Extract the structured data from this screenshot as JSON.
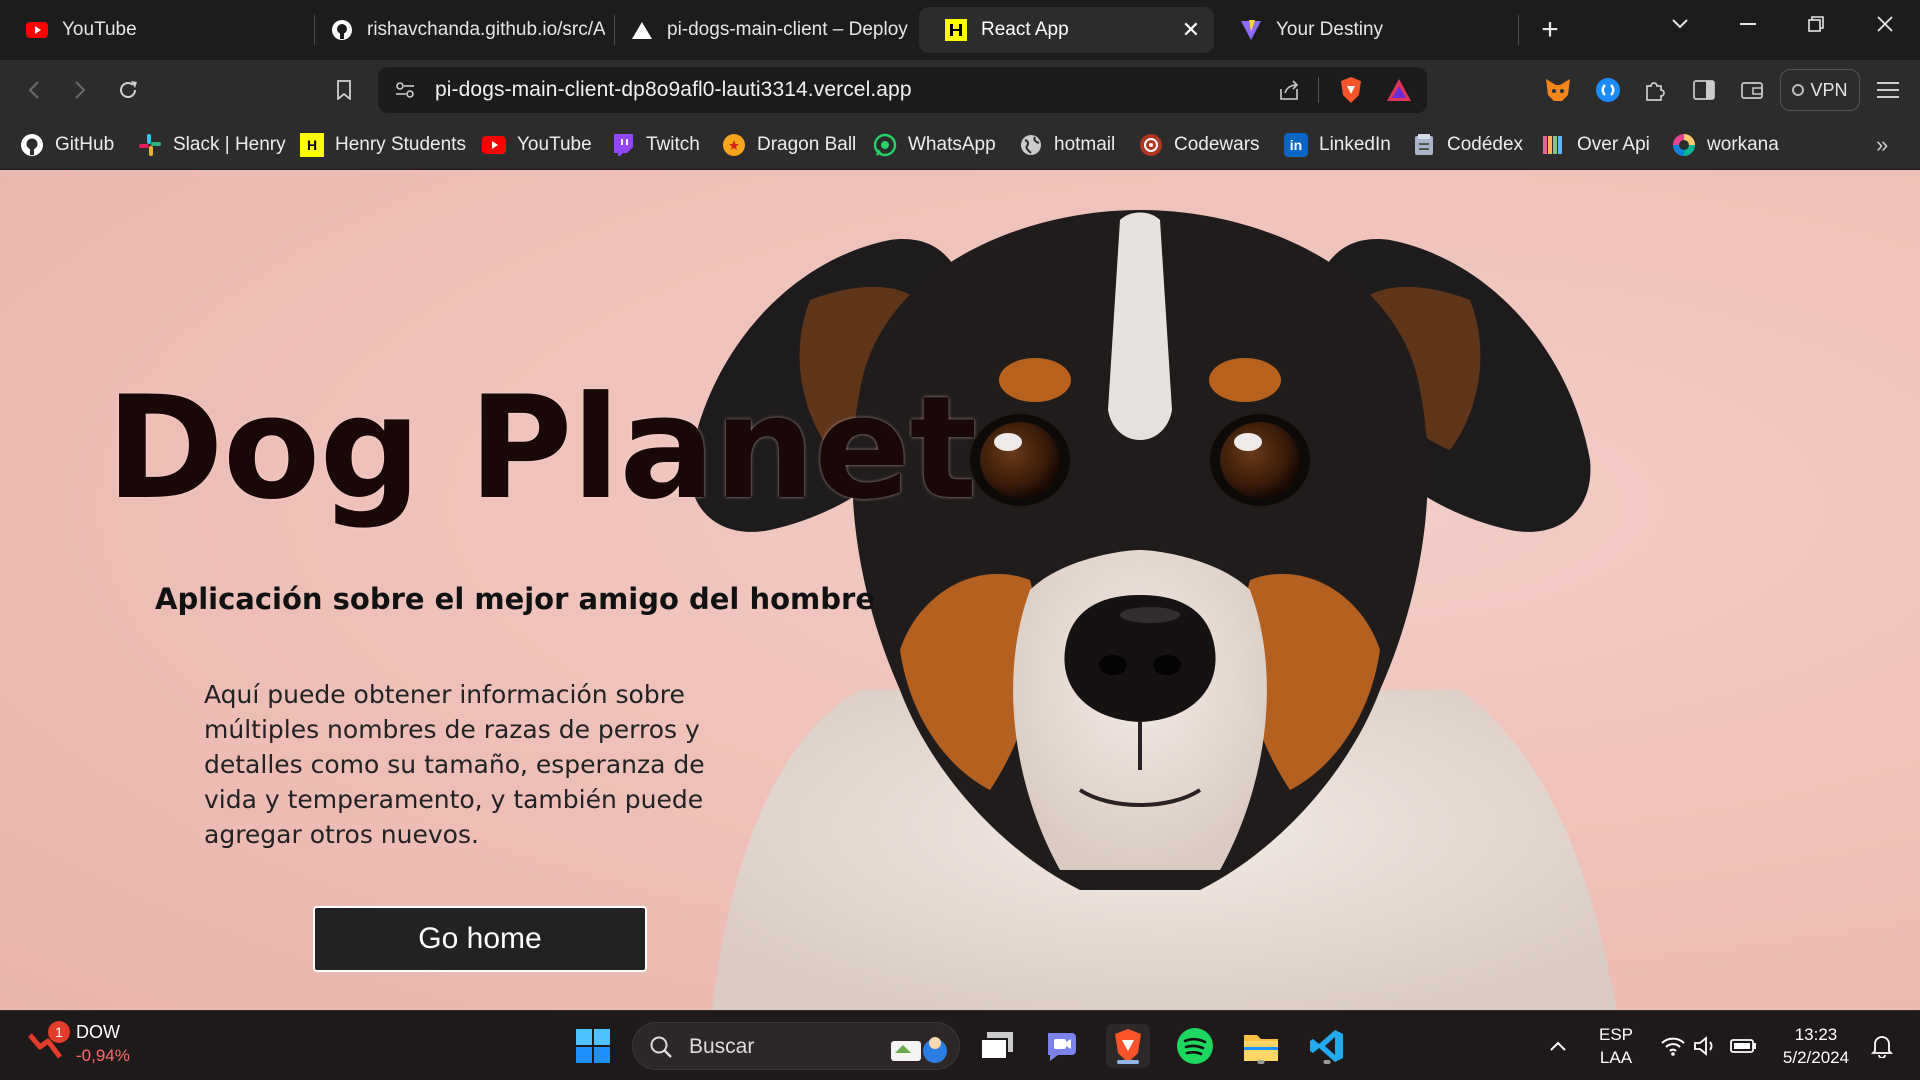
{
  "browser": {
    "tabs": [
      {
        "label": "YouTube",
        "icon": "youtube-icon"
      },
      {
        "label": "rishavchanda.github.io/src/Ap",
        "icon": "github-icon"
      },
      {
        "label": "pi-dogs-main-client – Deploy",
        "icon": "vercel-icon"
      },
      {
        "label": "React App",
        "icon": "henry-icon",
        "active": true
      },
      {
        "label": "Your Destiny",
        "icon": "vite-icon"
      }
    ],
    "url": "pi-dogs-main-client-dp8o9afl0-lauti3314.vercel.app",
    "vpn_label": "VPN"
  },
  "bookmarks": [
    {
      "label": "GitHub",
      "icon": "github-icon"
    },
    {
      "label": "Slack | Henry",
      "icon": "slack-icon"
    },
    {
      "label": "Henry Students",
      "icon": "henry-icon"
    },
    {
      "label": "YouTube",
      "icon": "youtube-icon"
    },
    {
      "label": "Twitch",
      "icon": "twitch-icon"
    },
    {
      "label": "Dragon Ball",
      "icon": "dragonball-icon"
    },
    {
      "label": "WhatsApp",
      "icon": "whatsapp-icon"
    },
    {
      "label": "hotmail",
      "icon": "globe-icon"
    },
    {
      "label": "Codewars",
      "icon": "codewars-icon"
    },
    {
      "label": "LinkedIn",
      "icon": "linkedin-icon"
    },
    {
      "label": "Codédex",
      "icon": "codedex-icon"
    },
    {
      "label": "Over Api",
      "icon": "overapi-icon"
    },
    {
      "label": "workana",
      "icon": "workana-icon"
    }
  ],
  "page": {
    "title": "Dog Planet",
    "subtitle": "Aplicación sobre el mejor amigo del hombre",
    "description": "Aquí puede obtener información sobre múltiples nombres de razas de perros y detalles como su tamaño, esperanza de vida y temperamento, y también puede agregar otros nuevos.",
    "button": "Go home"
  },
  "taskbar": {
    "stock_badge": "1",
    "stock_name": "DOW",
    "stock_change": "-0,94%",
    "search_placeholder": "Buscar",
    "lang_top": "ESP",
    "lang_bottom": "LAA",
    "time": "13:23",
    "date": "5/2/2024"
  },
  "colors": {
    "page_bg": "#efc2bb",
    "title": "#1a0808",
    "button_bg": "#222222",
    "chrome_bg": "#2c2c2c"
  }
}
